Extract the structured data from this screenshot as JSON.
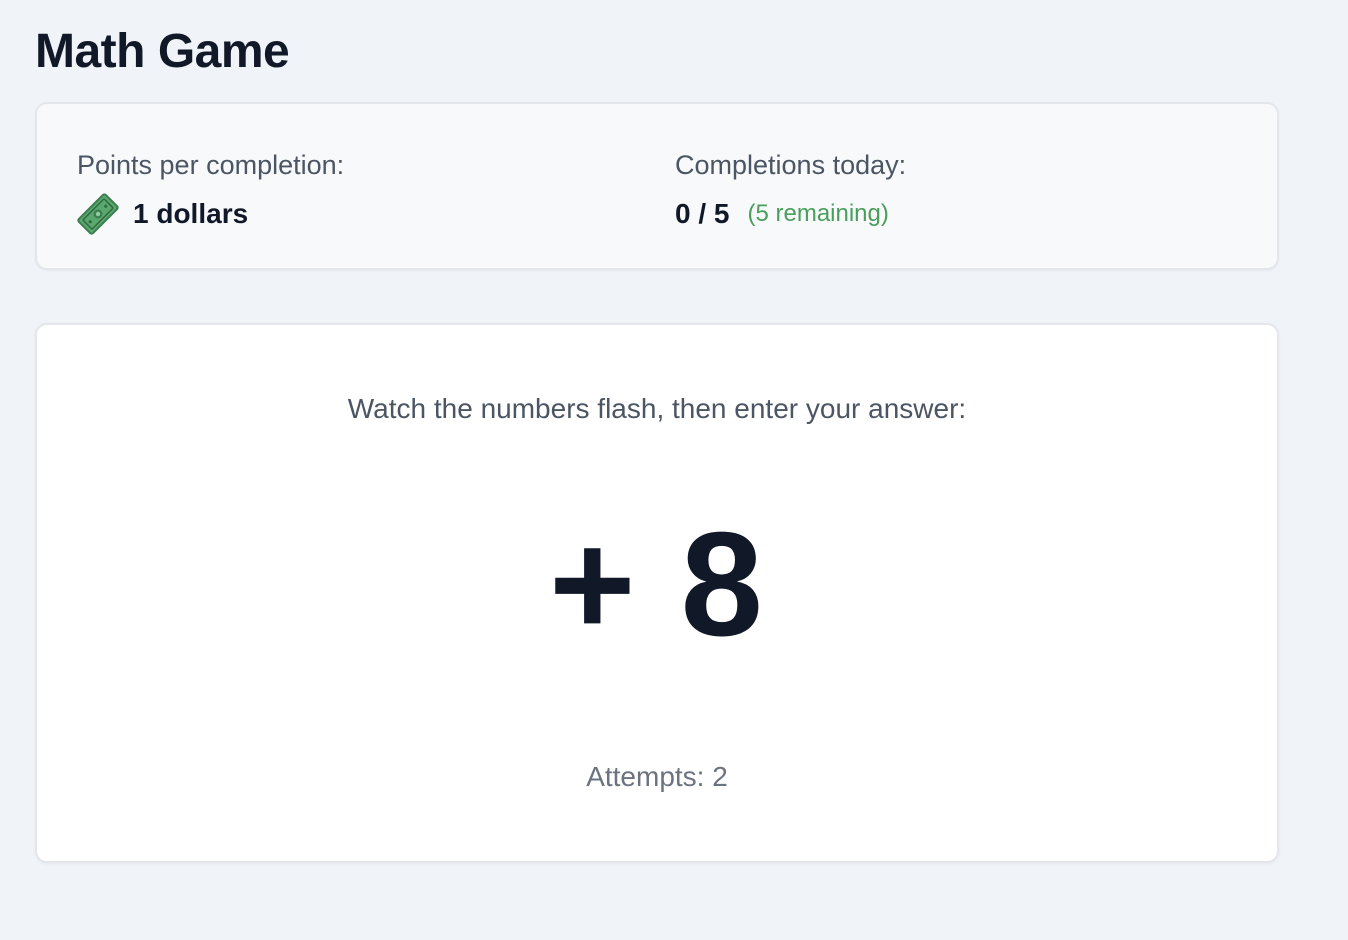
{
  "page": {
    "title": "Math Game"
  },
  "info": {
    "points_label": "Points per completion:",
    "points_value": "1 dollars",
    "points_icon": "money-bill-icon",
    "completions_label": "Completions today:",
    "completions_value": "0 / 5",
    "remaining_text": "(5 remaining)",
    "remaining_color": "#4a9e5c"
  },
  "game": {
    "instructions": "Watch the numbers flash, then enter your answer:",
    "flash_value": "+ 8",
    "attempts_text": "Attempts: 2"
  }
}
